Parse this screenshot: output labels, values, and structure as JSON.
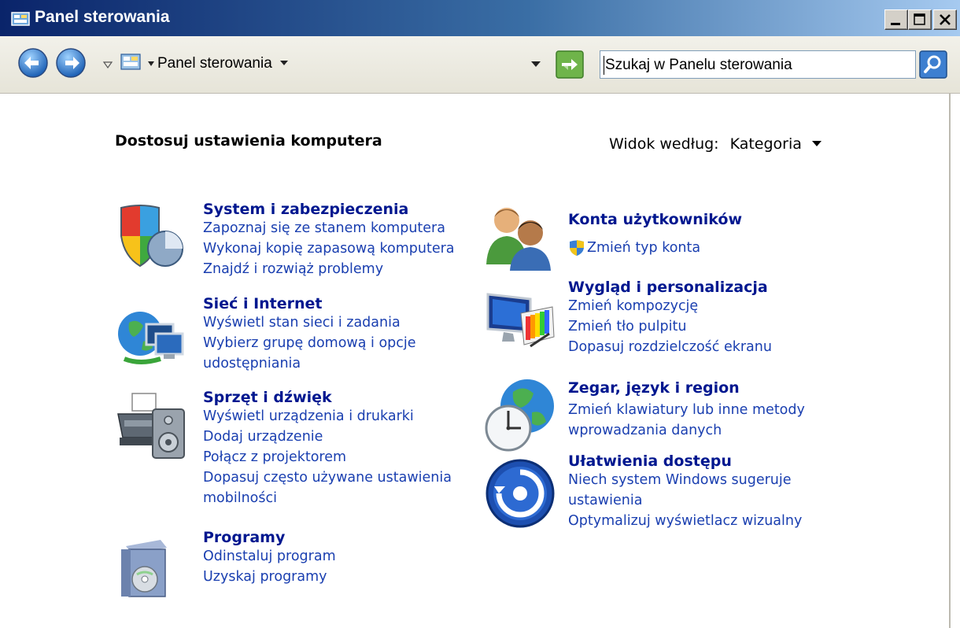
{
  "window": {
    "title": "Panel sterowania"
  },
  "navbar": {
    "breadcrumb": "Panel sterowania",
    "search_placeholder": "Szukaj w Panelu sterowania"
  },
  "content": {
    "heading": "Dostosuj ustawienia komputera",
    "view_label": "Widok według:",
    "view_value": "Kategoria"
  },
  "categories": [
    {
      "title": "System i zabezpieczenia",
      "links": [
        "Zapoznaj się ze stanem komputera",
        "Wykonaj kopię zapasową komputera",
        "Znajdź i rozwiąż problemy"
      ]
    },
    {
      "title": "Sieć i Internet",
      "links": [
        "Wyświetl stan sieci i zadania",
        "Wybierz grupę domową i opcje",
        "udostępniania"
      ]
    },
    {
      "title": "Sprzęt i dźwięk",
      "links": [
        "Wyświetl urządzenia i drukarki",
        "Dodaj urządzenie",
        "Połącz z projektorem",
        "Dopasuj często używane ustawienia",
        "mobilności"
      ]
    },
    {
      "title": "Programy",
      "links": [
        "Odinstaluj program",
        "Uzyskaj programy"
      ]
    },
    {
      "title": "Konta użytkowników",
      "links": [
        "Zmień typ konta"
      ]
    },
    {
      "title": "Wygląd i personalizacja",
      "links": [
        "Zmień kompozycję",
        "Zmień tło pulpitu",
        "Dopasuj rozdzielczość ekranu"
      ]
    },
    {
      "title": "Zegar, język i region",
      "links": [
        "Zmień klawiatury lub inne metody",
        "wprowadzania danych"
      ]
    },
    {
      "title": "Ułatwienia dostępu",
      "links": [
        "Niech system Windows sugeruje",
        "ustawienia",
        "Optymalizuj wyświetlacz wizualny"
      ]
    }
  ]
}
